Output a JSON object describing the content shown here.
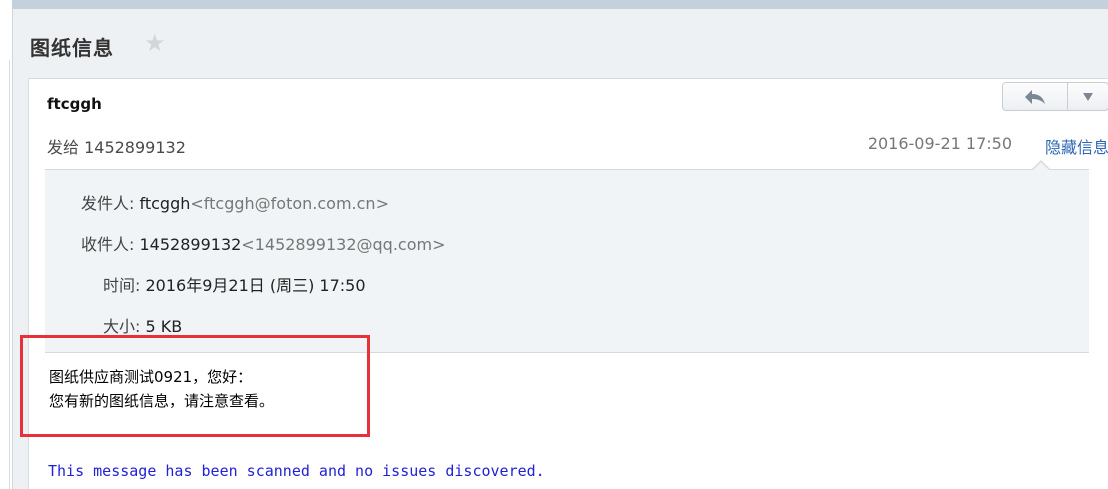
{
  "subject": {
    "title": "图纸信息",
    "star_icon": "star-icon"
  },
  "message": {
    "sender_name": "ftcggh",
    "to_line": "发给 1452899132",
    "date": "2016-09-21 17:50",
    "hide_details_label": "隐藏信息",
    "toolbar": {
      "reply_icon": "reply-arrow-icon",
      "more_icon": "chevron-down-icon"
    }
  },
  "details": {
    "from_label": "发件人:",
    "from_name": "ftcggh",
    "from_email": "<ftcggh@foton.com.cn>",
    "to_label": "收件人:",
    "to_name": "1452899132",
    "to_email": "<1452899132@qq.com>",
    "time_label": "时间:",
    "time_value": "2016年9月21日 (周三) 17:50",
    "size_label": "大小:",
    "size_value": "5 KB"
  },
  "body": {
    "line1": "图纸供应商测试0921，您好：",
    "line2": "您有新的图纸信息，请注意查看。",
    "scan_note": "This message has been scanned and no issues discovered."
  },
  "colors": {
    "accent_link": "#2e66b6",
    "highlight_box": "#e8303a",
    "scan_note": "#2121d8"
  }
}
